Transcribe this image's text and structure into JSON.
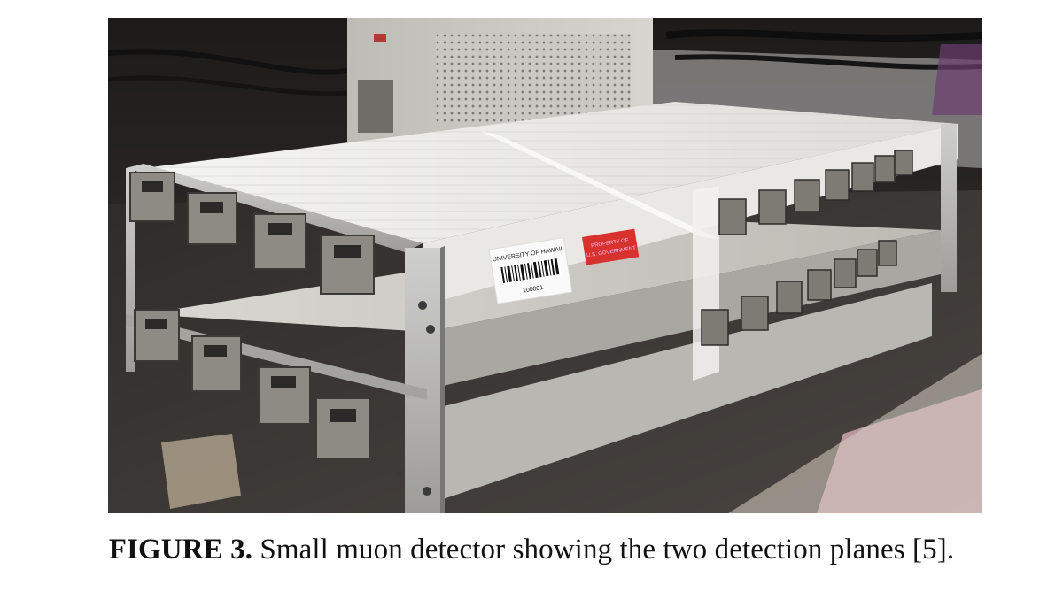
{
  "figure": {
    "label": "FIGURE 3.",
    "caption": "Small muon detector showing the two detection planes [5].",
    "photo": {
      "barcode_label_line1": "UNIVERSITY OF HAWAII",
      "barcode_number": "100001",
      "red_tag_line1": "PROPERTY OF",
      "red_tag_line2": "U.S. GOVERNMENT"
    }
  }
}
